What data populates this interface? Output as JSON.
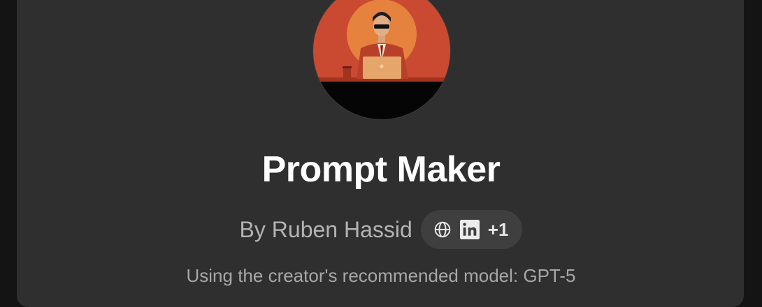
{
  "gpt": {
    "name": "Prompt Maker",
    "author": "By Ruben Hassid",
    "extra_links_count": "+1",
    "model_note": "Using the creator's recommended model: GPT-5"
  },
  "icons": {
    "globe": "globe-icon",
    "linkedin": "linkedin-icon"
  },
  "colors": {
    "modal_bg": "#2f2f2f",
    "avatar_red": "#c94a30",
    "pill_bg": "#3f3f3f"
  }
}
